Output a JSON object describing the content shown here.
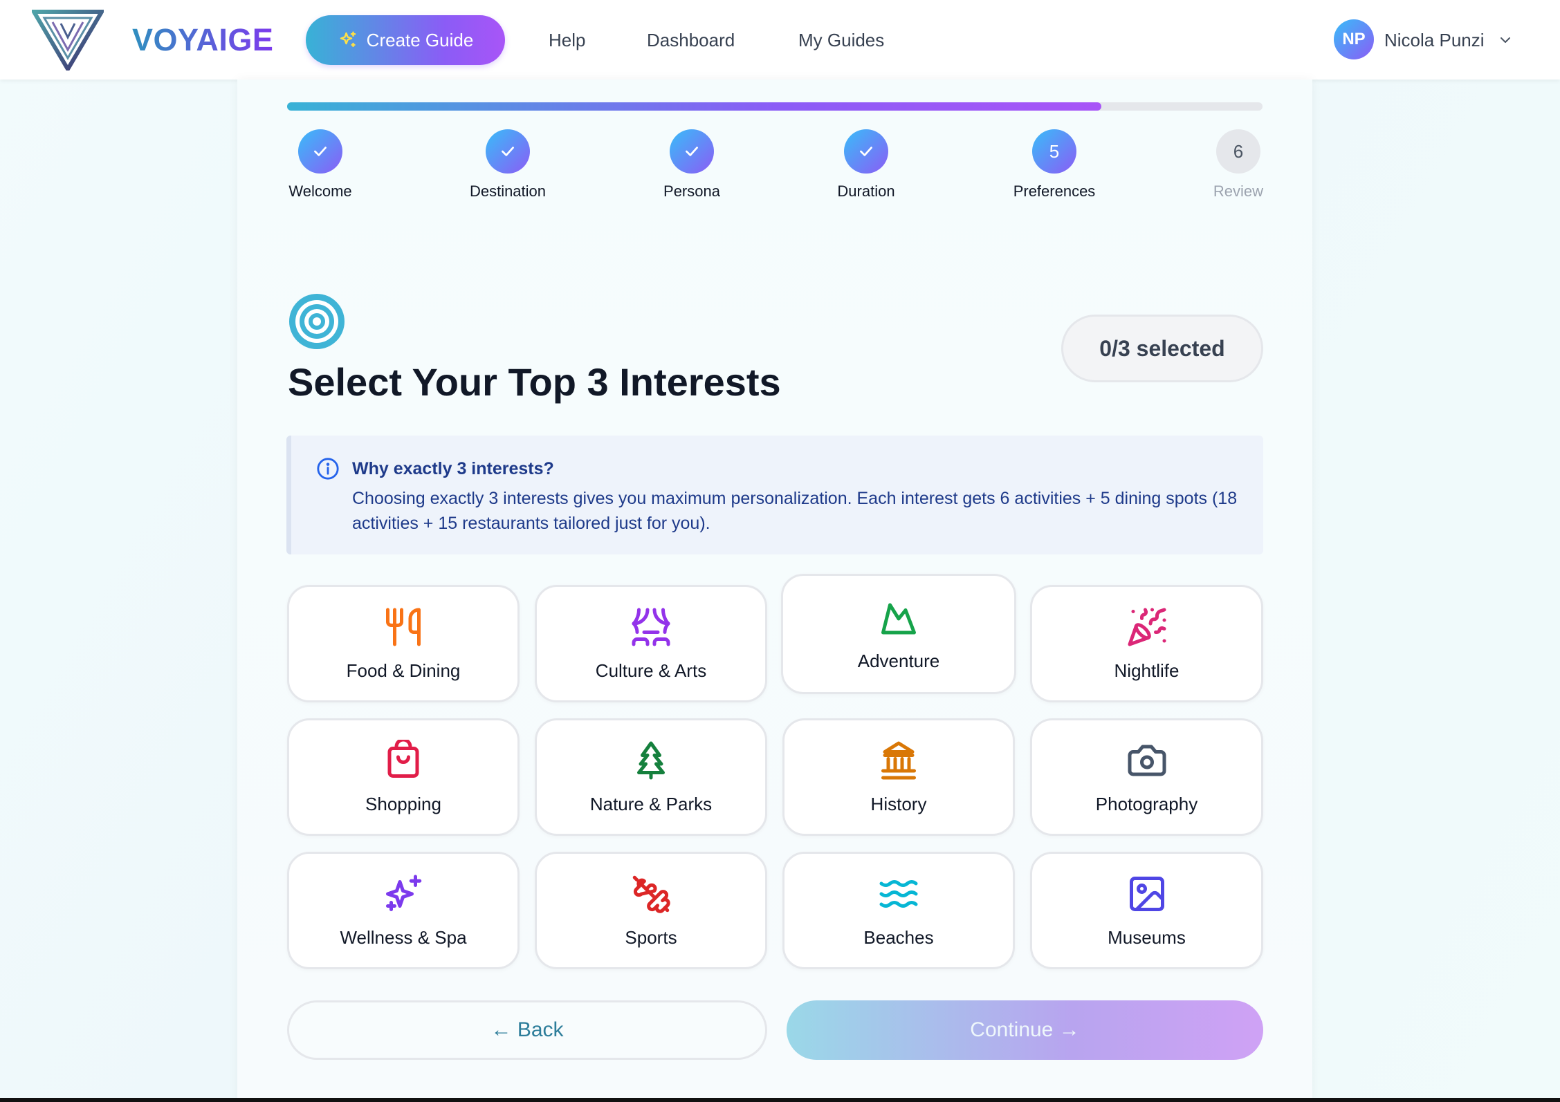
{
  "header": {
    "brand": "VOYAIGE",
    "create_label": "Create Guide",
    "nav": [
      "Help",
      "Dashboard",
      "My Guides"
    ],
    "user": {
      "initials": "NP",
      "name": "Nicola Punzi"
    }
  },
  "progress": {
    "fraction": 0.835,
    "steps": [
      {
        "num": "1",
        "label": "Welcome",
        "state": "done"
      },
      {
        "num": "2",
        "label": "Destination",
        "state": "done"
      },
      {
        "num": "3",
        "label": "Persona",
        "state": "done"
      },
      {
        "num": "4",
        "label": "Duration",
        "state": "done"
      },
      {
        "num": "5",
        "label": "Preferences",
        "state": "current"
      },
      {
        "num": "6",
        "label": "Review",
        "state": "pending"
      }
    ]
  },
  "main": {
    "title": "Select Your Top 3 Interests",
    "selected_count": "0/3 selected",
    "info": {
      "title": "Why exactly 3 interests?",
      "text": "Choosing exactly 3 interests gives you maximum personalization. Each interest gets 6 activities + 5 dining spots (18 activities + 15 restaurants tailored just for you)."
    },
    "interests": [
      {
        "label": "Food & Dining",
        "icon": "utensils-icon",
        "color": "#f97316"
      },
      {
        "label": "Culture & Arts",
        "icon": "theater-icon",
        "color": "#9333ea"
      },
      {
        "label": "Adventure",
        "icon": "mountain-icon",
        "color": "#16a34a"
      },
      {
        "label": "Nightlife",
        "icon": "party-popper-icon",
        "color": "#db2777"
      },
      {
        "label": "Shopping",
        "icon": "shopping-bag-icon",
        "color": "#e11d48"
      },
      {
        "label": "Nature & Parks",
        "icon": "tree-icon",
        "color": "#15803d"
      },
      {
        "label": "History",
        "icon": "landmark-icon",
        "color": "#d97706"
      },
      {
        "label": "Photography",
        "icon": "camera-icon",
        "color": "#475569"
      },
      {
        "label": "Wellness & Spa",
        "icon": "sparkles-icon",
        "color": "#7c3aed"
      },
      {
        "label": "Sports",
        "icon": "dumbbell-icon",
        "color": "#dc2626"
      },
      {
        "label": "Beaches",
        "icon": "waves-icon",
        "color": "#06b6d4"
      },
      {
        "label": "Museums",
        "icon": "image-icon",
        "color": "#4f46e5"
      }
    ],
    "back_label": "← Back",
    "continue_label": "Continue →"
  }
}
